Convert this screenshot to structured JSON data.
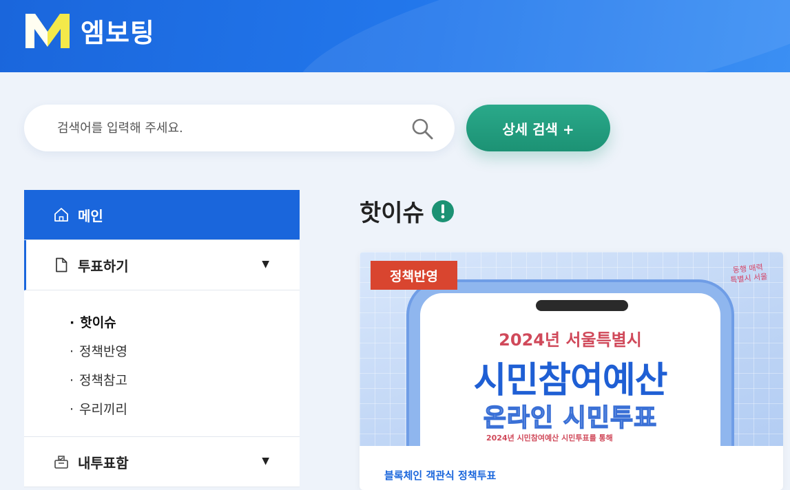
{
  "header": {
    "logo_letter": "M",
    "logo_text": "엠보팅",
    "brand_color": "#1a66dc"
  },
  "search": {
    "placeholder": "검색어를 입력해 주세요.",
    "icon": "search-icon",
    "detail_button_label": "상세 검색 +",
    "button_color": "#1c9274"
  },
  "sidebar": {
    "main_label": "메인",
    "main_icon": "home-icon",
    "vote_label": "투표하기",
    "vote_icon": "document-icon",
    "vote_sub": [
      {
        "label": "핫이슈",
        "active": true
      },
      {
        "label": "정책반영",
        "active": false
      },
      {
        "label": "정책참고",
        "active": false
      },
      {
        "label": "우리끼리",
        "active": false
      }
    ],
    "my_vote_label": "내투표함",
    "my_vote_icon": "ballot-box-icon",
    "expand_icon": "▼"
  },
  "main": {
    "section_title": "핫이슈",
    "section_icon": "alert-icon",
    "card": {
      "badge": "정책반영",
      "badge_color": "#d9452f",
      "stamp": "동행 매력\n특별시 서울",
      "poster_year_city": "2024년 서울특별시",
      "poster_title": "시민참여예산",
      "poster_subtitle": "온라인 시민투표",
      "poster_period": "2024년 시민참여예산 시민투표를 통해",
      "caption": "블록체인 객관식 정책투표"
    }
  }
}
